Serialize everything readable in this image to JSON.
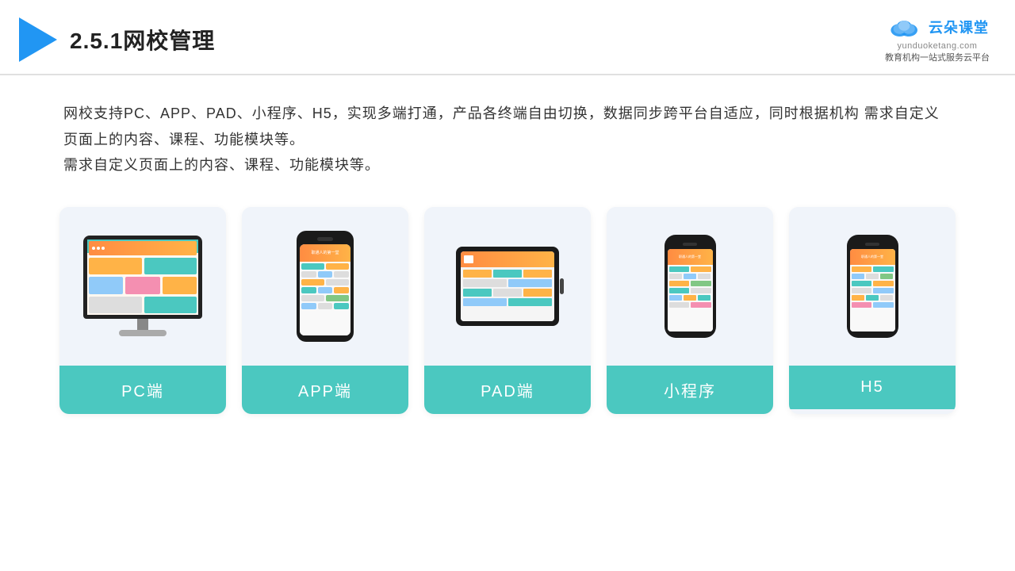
{
  "header": {
    "title": "2.5.1网校管理",
    "brand": {
      "name": "云朵课堂",
      "url": "yunduoketang.com",
      "subtitle": "教育机构一站\n式服务云平台"
    }
  },
  "description": "网校支持PC、APP、PAD、小程序、H5，实现多端打通，产品各终端自由切换，数据同步跨平台自适应，同时根据机构\n需求自定义页面上的内容、课程、功能模块等。",
  "cards": [
    {
      "id": "pc",
      "label": "PC端"
    },
    {
      "id": "app",
      "label": "APP端"
    },
    {
      "id": "pad",
      "label": "PAD端"
    },
    {
      "id": "miniapp",
      "label": "小程序"
    },
    {
      "id": "h5",
      "label": "H5"
    }
  ],
  "colors": {
    "accent": "#4bc8c0",
    "header_line": "#e0e0e0",
    "triangle": "#2196f3",
    "brand_blue": "#2196f3"
  }
}
